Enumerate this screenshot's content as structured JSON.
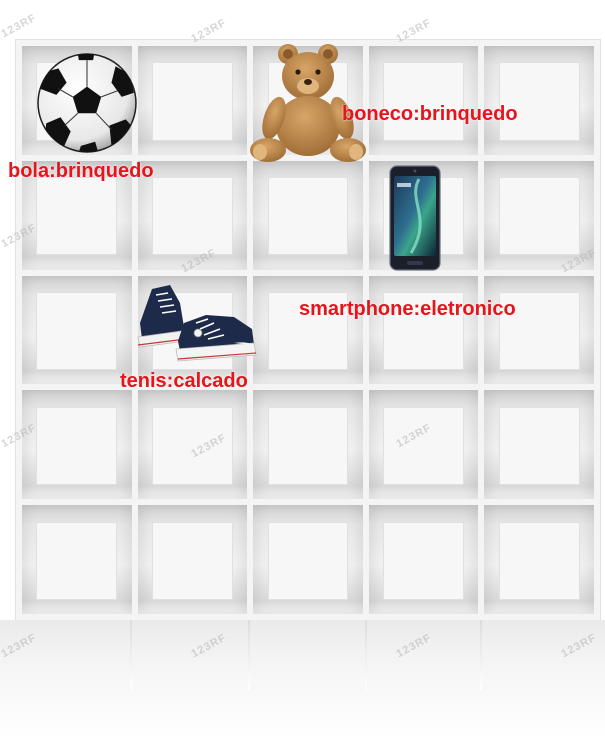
{
  "image": {
    "labels": {
      "ball": "bola:brinquedo",
      "teddy": "boneco:brinquedo",
      "phone": "smartphone:eletronico",
      "sneakers": "tenis:calcado"
    },
    "watermark_text": "123RF",
    "colors": {
      "label": "#e8141c",
      "shelf": "#f4f4f4",
      "teddy": "#c08a4e",
      "sneaker": "#1e2a4a",
      "phone": "#1a1f2a"
    },
    "icons": [
      "soccer-ball-icon",
      "teddy-bear-icon",
      "smartphone-icon",
      "sneakers-icon"
    ]
  }
}
